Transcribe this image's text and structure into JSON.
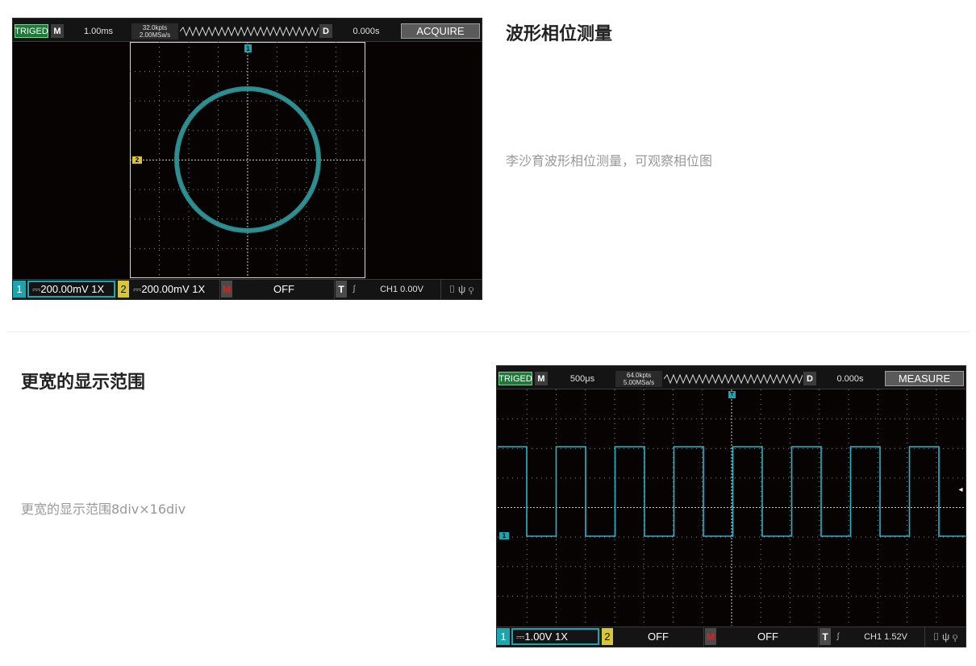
{
  "section1": {
    "title": "波形相位测量",
    "description": "李沙育波形相位测量，可观察相位图"
  },
  "section2": {
    "title": "更宽的显示范围",
    "description": "更宽的显示范围8div×16div"
  },
  "scope1": {
    "status": "TRIGED",
    "mode_letter": "M",
    "timebase": "1.00ms",
    "points": "32.0kpts",
    "sample_rate": "2.00MSa/s",
    "delay_letter": "D",
    "delay": "0.000s",
    "menu": "ACQUIRE",
    "ch1_marker": "1",
    "ch2_marker": "2",
    "bottom": {
      "ch1_num": "1",
      "ch1_setting": "⎓200.00mV 1X",
      "ch2_num": "2",
      "ch2_setting": "⎓200.00mV 1X",
      "math_letter": "M",
      "math_state": "OFF",
      "trig_letter": "T",
      "trig_edge": "∫",
      "trig_level": "CH1 0.00V",
      "icons": "⌷ ψ ⚲"
    }
  },
  "scope2": {
    "status": "TRIGED",
    "mode_letter": "M",
    "timebase": "500μs",
    "points": "64.0kpts",
    "sample_rate": "5.00MSa/s",
    "delay_letter": "D",
    "delay": "0.000s",
    "menu": "MEASURE",
    "trig_marker": "T",
    "ch1_marker": "1",
    "bottom": {
      "ch1_num": "1",
      "ch1_setting": "⎓1.00V 1X",
      "ch2_num": "2",
      "ch2_setting": "OFF",
      "math_letter": "M",
      "math_state": "OFF",
      "trig_letter": "T",
      "trig_edge": "∫",
      "trig_level": "CH1 1.52V",
      "icons": "⌷ ψ ⚲"
    }
  },
  "colors": {
    "trace": "#2a8a8c",
    "square_trace": "#29b3c9",
    "grid": "#8a8a8a",
    "ch1": "#1aa6b0",
    "ch2": "#d7c53a",
    "heading": "#222222",
    "description": "#999999"
  }
}
